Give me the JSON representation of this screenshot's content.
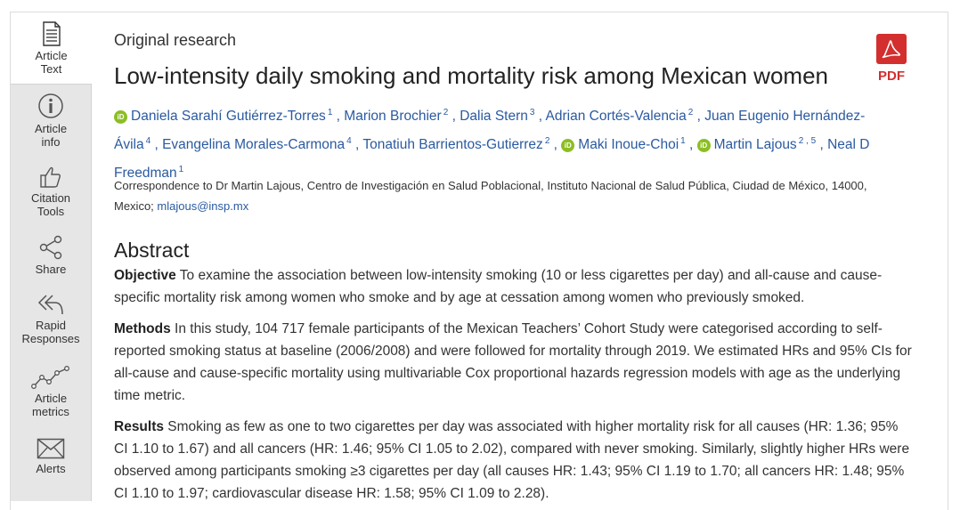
{
  "sidebar": {
    "items": [
      {
        "label": "Article\nText",
        "icon": "document-icon"
      },
      {
        "label": "Article\ninfo",
        "icon": "info-icon"
      },
      {
        "label": "Citation\nTools",
        "icon": "thumbs-up-icon"
      },
      {
        "label": "Share",
        "icon": "share-icon"
      },
      {
        "label": "Rapid\nResponses",
        "icon": "reply-all-icon"
      },
      {
        "label": "Article\nmetrics",
        "icon": "line-chart-icon"
      },
      {
        "label": "Alerts",
        "icon": "envelope-icon"
      }
    ]
  },
  "article": {
    "kicker": "Original research",
    "title": "Low-intensity daily smoking and mortality risk among Mexican women",
    "pdf_label": "PDF",
    "authors": [
      {
        "name": "Daniela Sarahí Gutiérrez-Torres",
        "sup": "1",
        "orcid": true
      },
      {
        "name": "Marion Brochier",
        "sup": "2",
        "orcid": false
      },
      {
        "name": "Dalia Stern",
        "sup": "3",
        "orcid": false
      },
      {
        "name": "Adrian Cortés-Valencia",
        "sup": "2",
        "orcid": false
      },
      {
        "name": "Juan Eugenio Hernández-Ávila",
        "sup": "4",
        "orcid": false
      },
      {
        "name": "Evangelina Morales-Carmona",
        "sup": "4",
        "orcid": false
      },
      {
        "name": "Tonatiuh Barrientos-Gutierrez",
        "sup": "2",
        "orcid": false
      },
      {
        "name": "Maki Inoue-Choi",
        "sup": "1",
        "orcid": true
      },
      {
        "name": "Martin Lajous",
        "sup": "2 ,  5",
        "orcid": true
      },
      {
        "name": "Neal D Freedman",
        "sup": "1",
        "orcid": false
      }
    ],
    "orcid_label": "iD",
    "correspondence_text": "Correspondence to Dr Martin Lajous, Centro de Investigación en Salud Poblacional, Instituto Nacional de Salud Pública, Ciudad de México, 14000, Mexico; ",
    "correspondence_email": "mlajous@insp.mx"
  },
  "abstract": {
    "heading": "Abstract",
    "objective_label": "Objective",
    "objective_text": " To examine the association between low-intensity smoking (10 or less cigarettes per day) and all-cause and cause-specific mortality risk among women who smoke and by age at cessation among women who previously smoked.",
    "methods_label": "Methods",
    "methods_text": " In this study, 104 717 female participants of the Mexican Teachers’ Cohort Study were categorised according to self-reported smoking status at baseline (2006/2008) and were followed for mortality through 2019. We estimated HRs and 95% CIs for all-cause and cause-specific mortality using multivariable Cox proportional hazards regression models with age as the underlying time metric.",
    "results_label": "Results",
    "results_text": " Smoking as few as one to two cigarettes per day was associated with higher mortality risk for all causes (HR: 1.36; 95% CI 1.10 to 1.67) and all cancers (HR: 1.46; 95% CI 1.05 to 2.02), compared with never smoking. Similarly, slightly higher HRs were observed among participants smoking ≥3 cigarettes per day (all causes HR: 1.43; 95% CI 1.19 to 1.70; all cancers HR: 1.48; 95% CI 1.10 to 1.97; cardiovascular disease HR: 1.58; 95% CI 1.09 to 2.28)."
  }
}
